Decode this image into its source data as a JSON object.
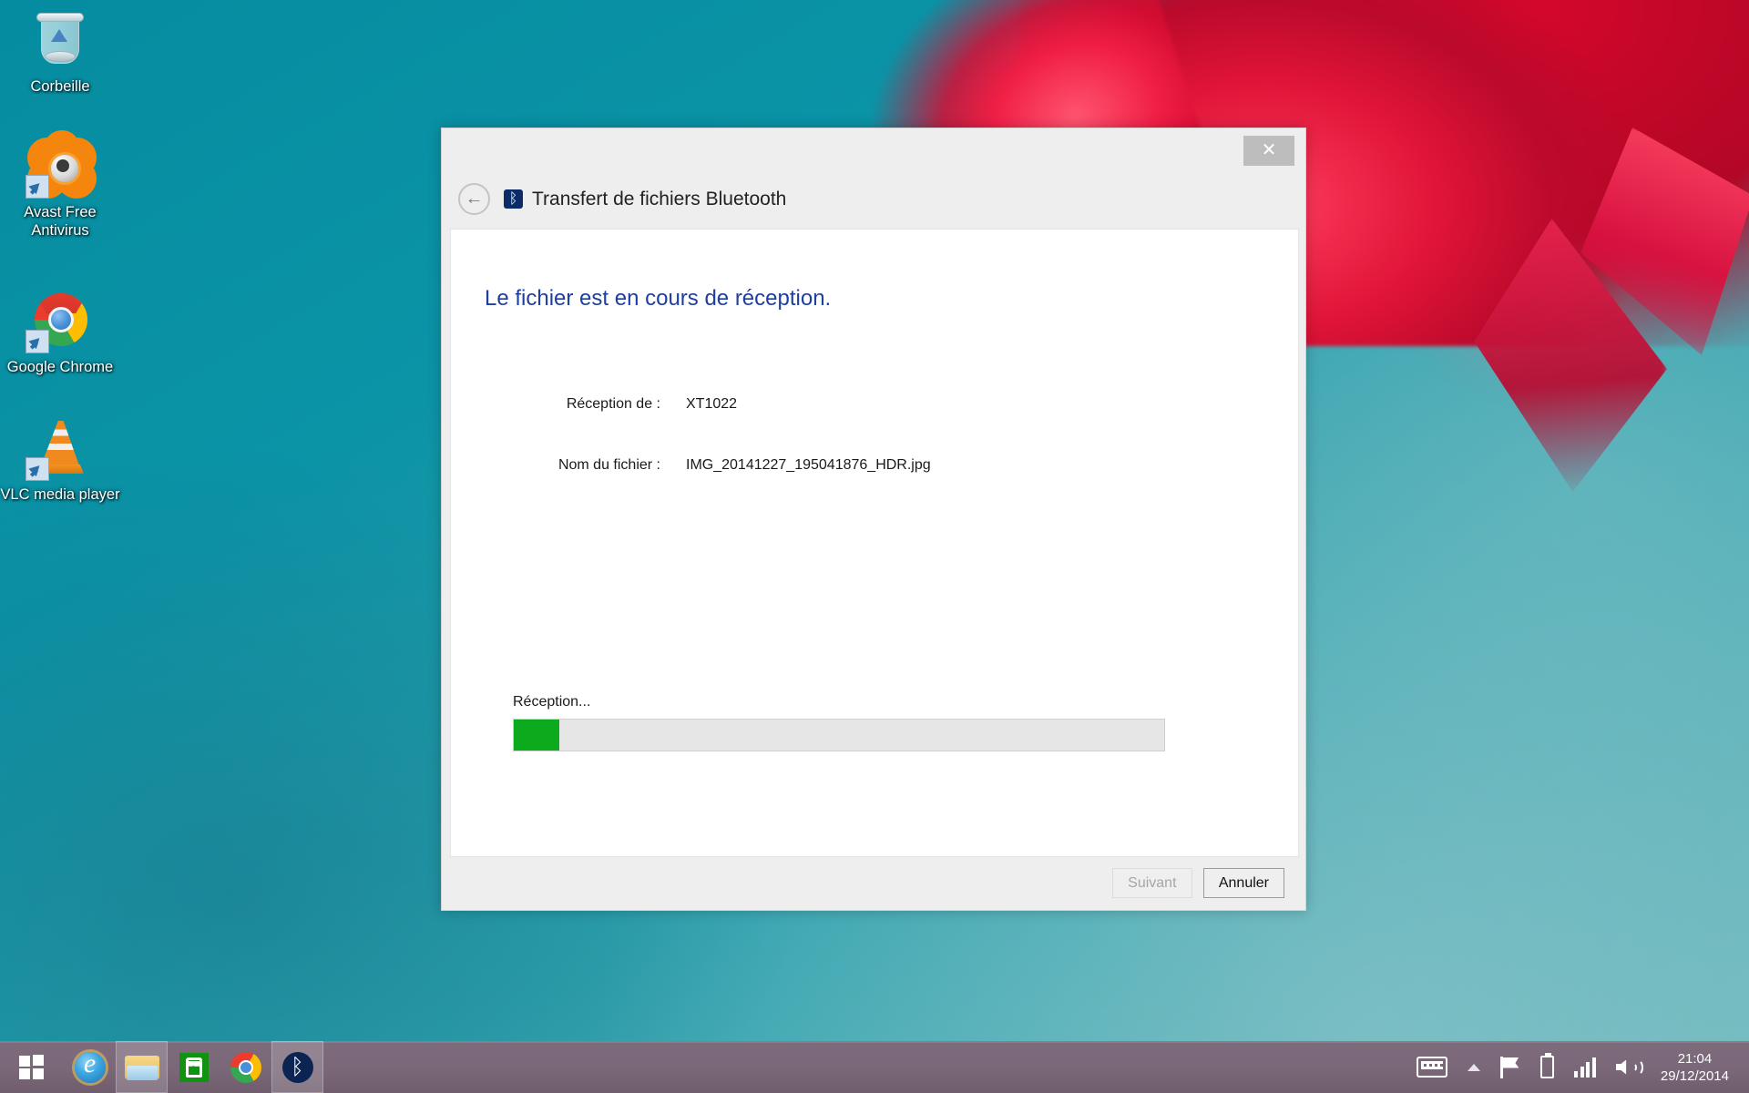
{
  "desktop": {
    "icons": [
      {
        "name": "recycle-bin",
        "label": "Corbeille"
      },
      {
        "name": "avast",
        "label": "Avast Free\nAntivirus",
        "line1": "Avast Free",
        "line2": "Antivirus"
      },
      {
        "name": "chrome",
        "label": "Google Chrome"
      },
      {
        "name": "vlc",
        "label": "VLC media player"
      }
    ]
  },
  "dialog": {
    "title": "Transfert de fichiers Bluetooth",
    "close_label": "✕",
    "back_label": "←",
    "bluetooth_glyph": "ᛒ",
    "headline": "Le fichier est en cours de réception.",
    "fields": [
      {
        "label": "Réception de :",
        "value": "XT1022"
      },
      {
        "label": "Nom du fichier :",
        "value": "IMG_20141227_195041876_HDR.jpg"
      }
    ],
    "progress": {
      "label": "Réception...",
      "percent": 7,
      "fill_color": "#0cab1e",
      "track_color": "#e6e6e6"
    },
    "buttons": {
      "next": "Suivant",
      "cancel": "Annuler"
    }
  },
  "taskbar": {
    "items": [
      {
        "name": "start",
        "title": "Démarrer"
      },
      {
        "name": "internet-explorer",
        "title": "Internet Explorer"
      },
      {
        "name": "file-explorer",
        "title": "Explorateur de fichiers"
      },
      {
        "name": "store",
        "title": "Store"
      },
      {
        "name": "chrome",
        "title": "Google Chrome"
      },
      {
        "name": "bluetooth",
        "title": "Bluetooth"
      }
    ],
    "tray": {
      "keyboard": "Clavier tactile",
      "chevron": "Afficher les icônes masquées",
      "flag": "Centre de maintenance",
      "battery": "Batterie",
      "network": "Réseau",
      "volume": "Volume",
      "bluetooth_glyph": "ᛒ"
    },
    "clock": {
      "time": "21:04",
      "date": "29/12/2014"
    }
  }
}
